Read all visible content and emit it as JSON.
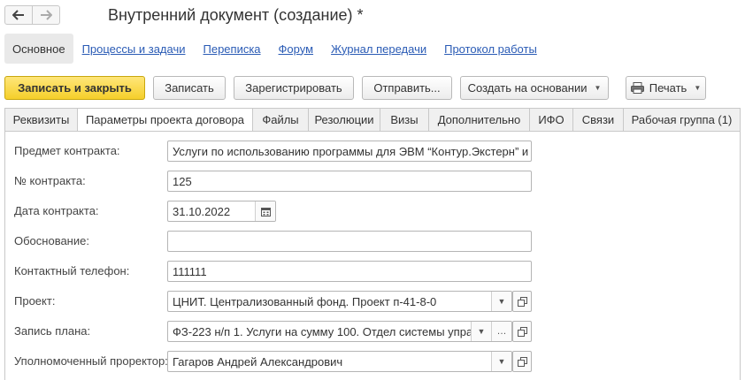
{
  "window": {
    "title": "Внутренний документ (создание) *"
  },
  "nav": {
    "back_icon": "arrow-left-icon",
    "forward_icon": "arrow-right-icon"
  },
  "section_tabs": {
    "active": "Основное",
    "links": [
      "Процессы и задачи",
      "Переписка",
      "Форум",
      "Журнал передачи",
      "Протокол работы"
    ]
  },
  "toolbar": {
    "save_close": "Записать и закрыть",
    "save": "Записать",
    "register": "Зарегистрировать",
    "send": "Отправить...",
    "create_based": "Создать на основании",
    "print": "Печать",
    "print_icon": "printer-icon",
    "accent_color": "#f5cf2a"
  },
  "form_tabs": {
    "active_index": 1,
    "items": [
      "Реквизиты",
      "Параметры проекта договора",
      "Файлы",
      "Резолюции",
      "Визы",
      "Дополнительно",
      "ИФО",
      "Связи",
      "Рабочая группа (1)"
    ]
  },
  "form": {
    "subject": {
      "label": "Предмет контракта:",
      "value": "Услуги по использованию программы для ЭВМ “Контур.Экстерн” и"
    },
    "number": {
      "label": "№ контракта:",
      "value": "125"
    },
    "date": {
      "label": "Дата контракта:",
      "value": "31.10.2022",
      "icon": "calendar-icon"
    },
    "basis": {
      "label": "Обоснование:",
      "value": ""
    },
    "phone": {
      "label": "Контактный телефон:",
      "value": "111111"
    },
    "project": {
      "label": "Проект:",
      "value": "ЦНИТ. Централизованный фонд. Проект п-41-8-0"
    },
    "plan": {
      "label": "Запись плана:",
      "value": "ФЗ-223 н/п 1. Услуги на сумму 100. Отдел системы упра"
    },
    "designer": {
      "label": "Уполномоченный проректор:",
      "value": "Гагаров Андрей Александрович"
    }
  }
}
